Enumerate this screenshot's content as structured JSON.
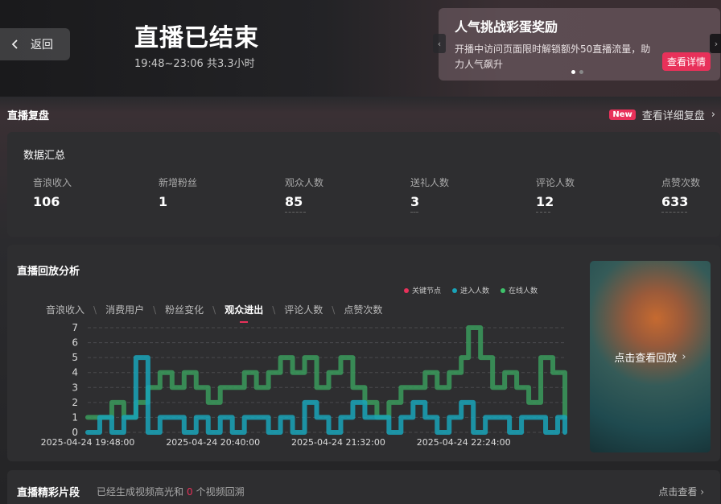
{
  "header": {
    "back_label": "返回",
    "title": "直播已结束",
    "subtitle": "19:48~23:06 共3.3小时"
  },
  "banner": {
    "title": "人气挑战彩蛋奖励",
    "text": "开播中访问页面限时解锁额外50直播流量，助力人气飙升",
    "button": "查看详情",
    "page_count": 2,
    "active_page": 1
  },
  "review": {
    "title": "直播复盘",
    "badge": "New",
    "link": "查看详细复盘"
  },
  "summary": {
    "title": "数据汇总",
    "metrics": [
      {
        "label": "音浪收入",
        "value": "106"
      },
      {
        "label": "新增粉丝",
        "value": "1"
      },
      {
        "label": "观众人数",
        "value": "85"
      },
      {
        "label": "送礼人数",
        "value": "3"
      },
      {
        "label": "评论人数",
        "value": "12"
      },
      {
        "label": "点赞次数",
        "value": "633"
      }
    ]
  },
  "analysis": {
    "title": "直播回放分析",
    "tabs": [
      "音浪收入",
      "消费用户",
      "粉丝变化",
      "观众进出",
      "评论人数",
      "点赞次数"
    ],
    "active_tab": "观众进出",
    "replay_label": "点击查看回放"
  },
  "highlights": {
    "title": "直播精彩片段",
    "desc_prefix": "已经生成视频高光和",
    "count": "0",
    "desc_suffix": "个视频回溯",
    "more": "点击查看"
  },
  "colors": {
    "accent": "#e8315a",
    "key_node": "#e8315a",
    "enter": "#19a3b8",
    "online": "#3a9a5c"
  },
  "chart_data": {
    "type": "line",
    "legend": [
      "关键节点",
      "进入人数",
      "在线人数"
    ],
    "legend_placement": "top-right",
    "ylim": [
      0,
      7
    ],
    "yticks": [
      "0",
      "1",
      "2",
      "3",
      "4",
      "5",
      "6",
      "7"
    ],
    "xlim": [
      "19:48",
      "23:06"
    ],
    "xticks": [
      "2025-04-24 19:48:00",
      "2025-04-24 20:40:00",
      "2025-04-24 21:32:00",
      "2025-04-24 22:24:00"
    ],
    "grid": true,
    "series": [
      {
        "name": "在线人数",
        "color": "#3a9a5c",
        "points": [
          [
            "19:48",
            1
          ],
          [
            "19:53",
            1
          ],
          [
            "19:58",
            2
          ],
          [
            "20:03",
            1
          ],
          [
            "20:08",
            2
          ],
          [
            "20:13",
            3
          ],
          [
            "20:18",
            4
          ],
          [
            "20:23",
            3
          ],
          [
            "20:28",
            4
          ],
          [
            "20:33",
            3
          ],
          [
            "20:38",
            2
          ],
          [
            "20:43",
            3
          ],
          [
            "20:48",
            3
          ],
          [
            "20:53",
            4
          ],
          [
            "20:58",
            3
          ],
          [
            "21:03",
            4
          ],
          [
            "21:08",
            5
          ],
          [
            "21:13",
            4
          ],
          [
            "21:18",
            5
          ],
          [
            "21:23",
            3
          ],
          [
            "21:28",
            4
          ],
          [
            "21:33",
            5
          ],
          [
            "21:38",
            3
          ],
          [
            "21:43",
            2
          ],
          [
            "21:48",
            1
          ],
          [
            "21:53",
            2
          ],
          [
            "21:58",
            3
          ],
          [
            "22:03",
            3
          ],
          [
            "22:08",
            4
          ],
          [
            "22:13",
            3
          ],
          [
            "22:18",
            4
          ],
          [
            "22:23",
            5
          ],
          [
            "22:26",
            7
          ],
          [
            "22:31",
            5
          ],
          [
            "22:36",
            3
          ],
          [
            "22:41",
            4
          ],
          [
            "22:46",
            3
          ],
          [
            "22:51",
            2
          ],
          [
            "22:56",
            5
          ],
          [
            "23:01",
            4
          ],
          [
            "23:06",
            1
          ]
        ]
      },
      {
        "name": "进入人数",
        "color": "#19a3b8",
        "points": [
          [
            "19:48",
            0
          ],
          [
            "19:53",
            1
          ],
          [
            "19:58",
            0
          ],
          [
            "20:03",
            1
          ],
          [
            "20:08",
            5
          ],
          [
            "20:13",
            0
          ],
          [
            "20:18",
            1
          ],
          [
            "20:23",
            1
          ],
          [
            "20:28",
            0
          ],
          [
            "20:33",
            1
          ],
          [
            "20:38",
            0
          ],
          [
            "20:43",
            1
          ],
          [
            "20:48",
            0
          ],
          [
            "20:53",
            1
          ],
          [
            "20:58",
            1
          ],
          [
            "21:03",
            0
          ],
          [
            "21:08",
            1
          ],
          [
            "21:13",
            0
          ],
          [
            "21:18",
            2
          ],
          [
            "21:23",
            1
          ],
          [
            "21:28",
            0
          ],
          [
            "21:33",
            1
          ],
          [
            "21:38",
            2
          ],
          [
            "21:43",
            1
          ],
          [
            "21:48",
            1
          ],
          [
            "21:53",
            0
          ],
          [
            "21:58",
            1
          ],
          [
            "22:03",
            2
          ],
          [
            "22:08",
            1
          ],
          [
            "22:13",
            0
          ],
          [
            "22:18",
            1
          ],
          [
            "22:23",
            2
          ],
          [
            "22:28",
            0
          ],
          [
            "22:33",
            1
          ],
          [
            "22:38",
            1
          ],
          [
            "22:43",
            0
          ],
          [
            "22:48",
            1
          ],
          [
            "22:53",
            1
          ],
          [
            "22:58",
            0
          ],
          [
            "23:03",
            1
          ],
          [
            "23:06",
            0
          ]
        ]
      }
    ]
  }
}
